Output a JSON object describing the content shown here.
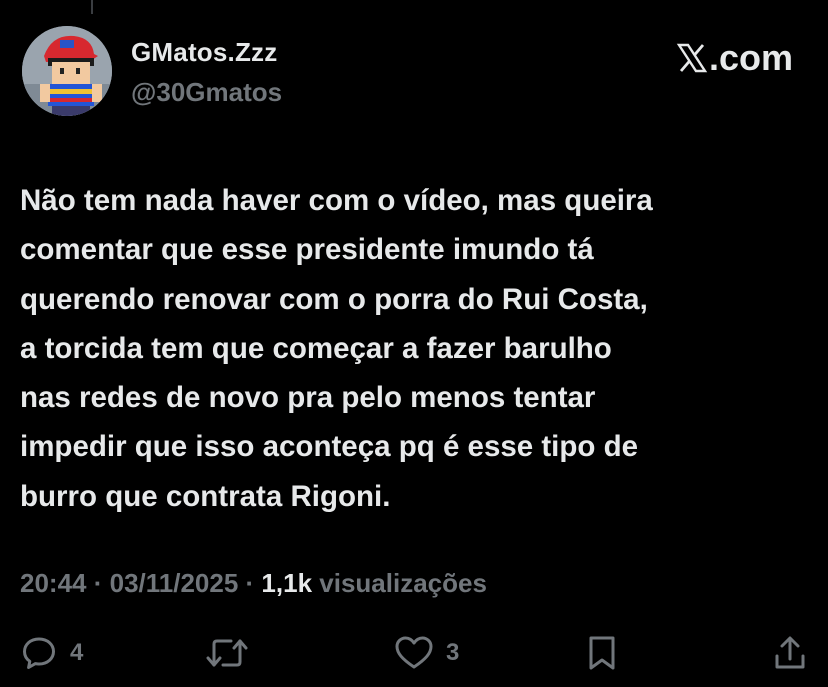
{
  "author": {
    "display_name": "GMatos.Zzz",
    "handle": "@30Gmatos",
    "avatar_icon": "pixel-character-avatar"
  },
  "brand": {
    "label": ".com",
    "icon": "x-logo-icon"
  },
  "tweet": {
    "text": "Não tem nada haver com o vídeo, mas queira\ncomentar que esse presidente imundo tá\nquerendo renovar com o porra do Rui Costa,\na torcida tem que começar a fazer barulho\nnas redes de novo pra pelo menos tentar\nimpedir que isso aconteça pq é esse tipo de\nburro que contrata Rigoni."
  },
  "meta": {
    "time": "20:44",
    "date": "03/11/2025",
    "separator": " · ",
    "views_count": "1,1k",
    "views_label": " visualizações"
  },
  "actions": {
    "reply_count": "4",
    "repost_count": "",
    "like_count": "3"
  },
  "colors": {
    "background": "#000000",
    "primary_text": "#e7e9ea",
    "secondary_text": "#71767b"
  }
}
